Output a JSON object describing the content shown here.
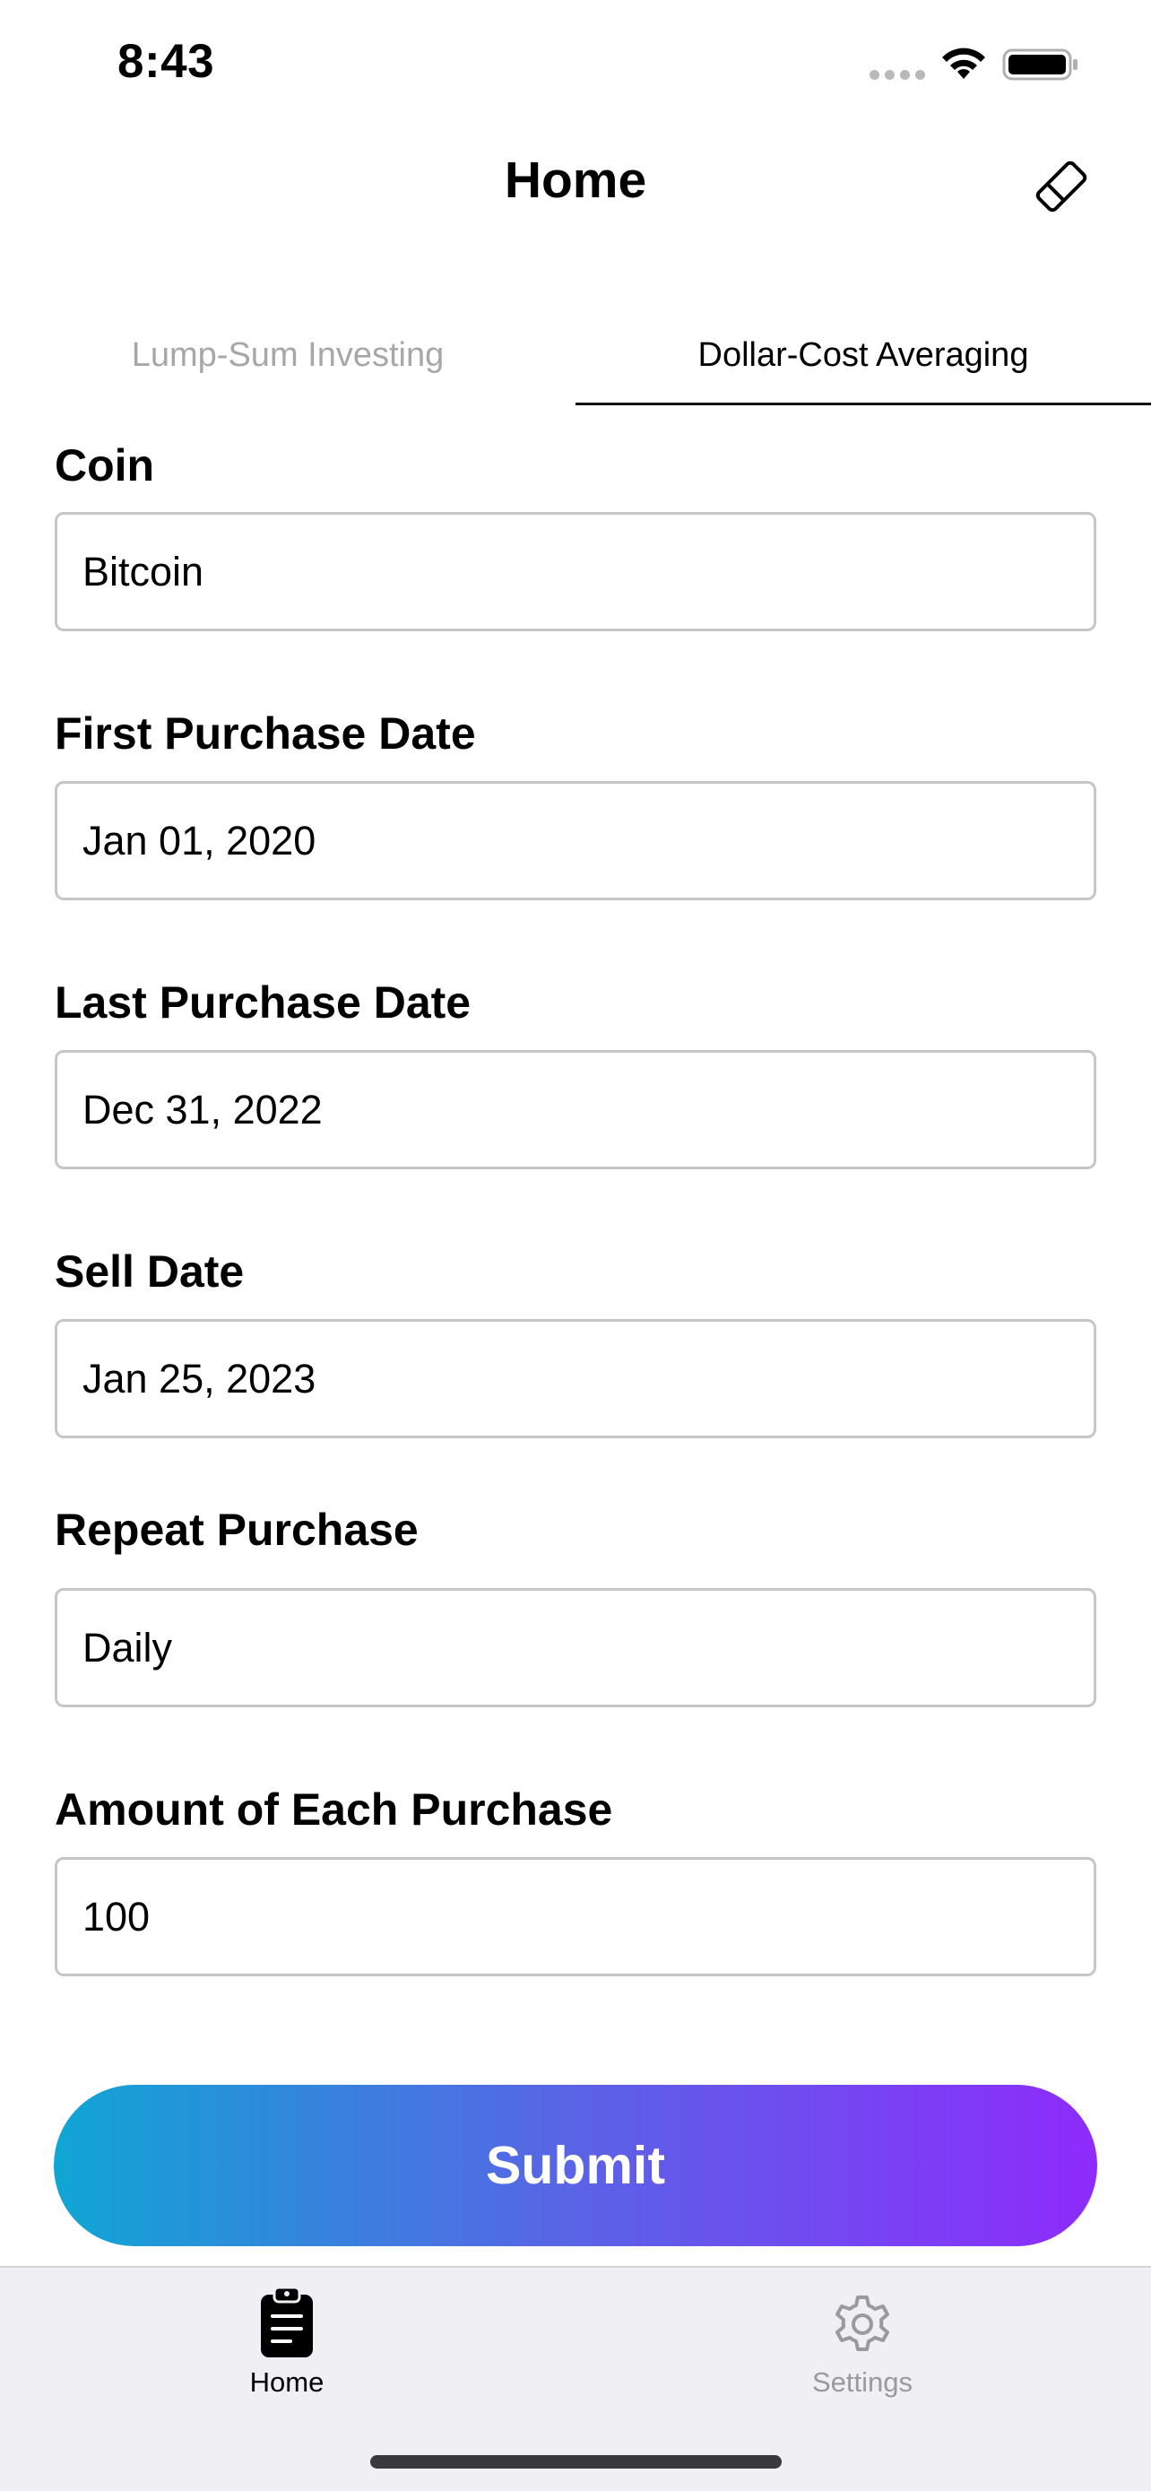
{
  "status_bar": {
    "time": "8:43"
  },
  "nav": {
    "title": "Home",
    "clear_icon": "eraser-icon"
  },
  "tabs": [
    {
      "label": "Lump-Sum Investing",
      "active": false
    },
    {
      "label": "Dollar-Cost Averaging",
      "active": true
    }
  ],
  "form": {
    "coin": {
      "label": "Coin",
      "value": "Bitcoin"
    },
    "first_purchase_date": {
      "label": "First Purchase Date",
      "value": "Jan 01, 2020"
    },
    "last_purchase_date": {
      "label": "Last Purchase Date",
      "value": "Dec 31, 2022"
    },
    "sell_date": {
      "label": "Sell Date",
      "value": "Jan 25, 2023"
    },
    "repeat_purchase": {
      "label": "Repeat Purchase",
      "value": "Daily"
    },
    "amount_each_purchase": {
      "label": "Amount of Each Purchase",
      "value": "100"
    }
  },
  "submit": {
    "label": "Submit"
  },
  "tab_bar": [
    {
      "label": "Home",
      "icon": "clipboard-icon",
      "active": true
    },
    {
      "label": "Settings",
      "icon": "gear-icon",
      "active": false
    }
  ],
  "colors": {
    "gradient_start": "#10a6d4",
    "gradient_mid": "#5a63e6",
    "gradient_end": "#8e2bfc",
    "inactive_text": "#a7a7a7",
    "border": "#c6c6c8"
  }
}
